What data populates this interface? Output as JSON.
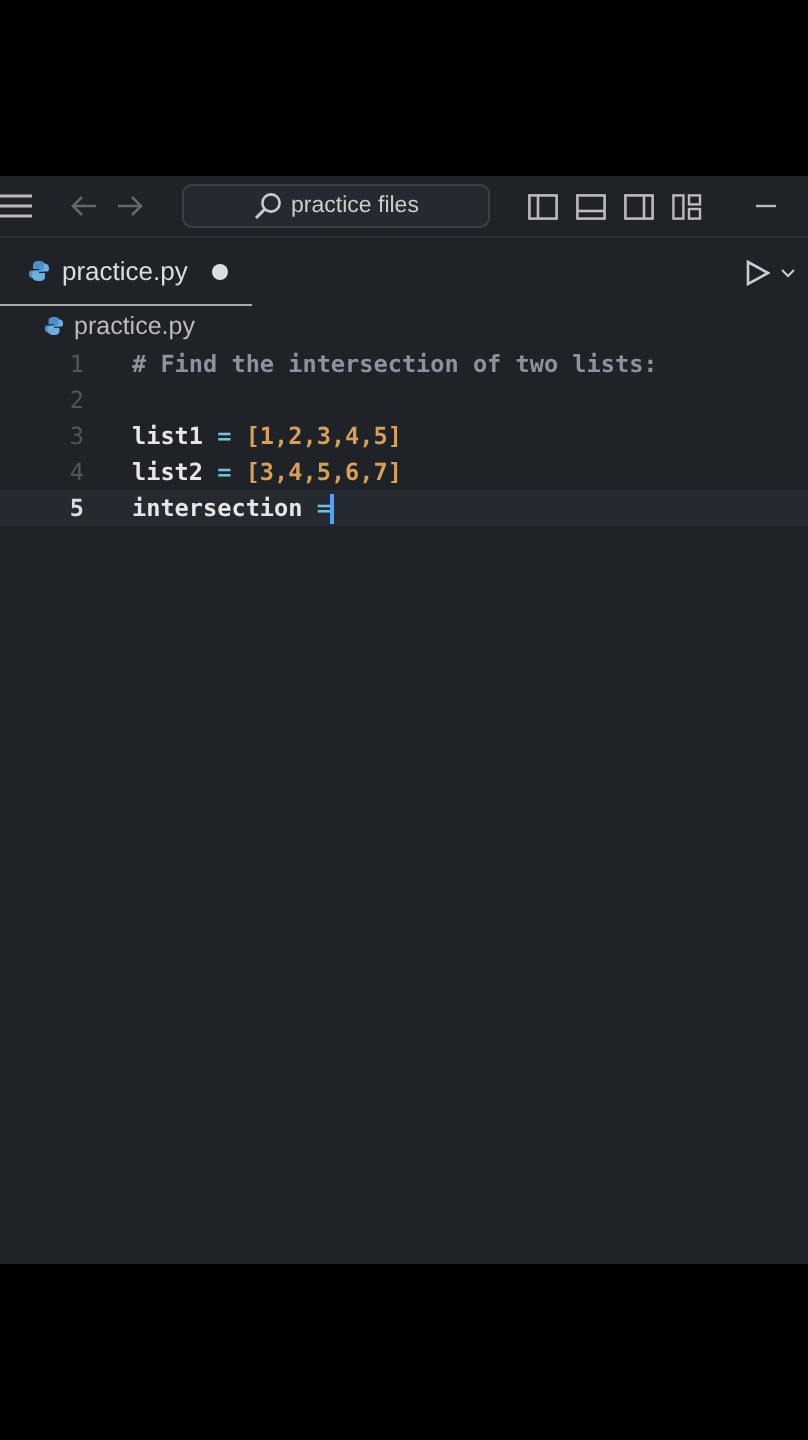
{
  "title_bar": {
    "search": {
      "value": "practice files"
    }
  },
  "tabs": [
    {
      "label": "practice.py",
      "selected": true,
      "modified": true
    }
  ],
  "breadcrumb": "practice.py",
  "editor": {
    "lines": [
      {
        "number": "1",
        "current": false,
        "tokens": [
          {
            "text": "# Find the intersection of two lists:",
            "kind": "comment"
          }
        ]
      },
      {
        "number": "2",
        "current": false
      },
      {
        "number": "3",
        "current": false,
        "tokens": [
          {
            "text": "list1",
            "kind": "name"
          },
          {
            "text": " = ",
            "kind": "op"
          },
          {
            "text": "[1,2,3,4,5]",
            "kind": "bracket"
          }
        ]
      },
      {
        "number": "4",
        "current": false,
        "tokens": [
          {
            "text": "list2",
            "kind": "name"
          },
          {
            "text": " = ",
            "kind": "op"
          },
          {
            "text": "[3,4,5,6,7]",
            "kind": "bracket"
          }
        ]
      },
      {
        "number": "5",
        "current": true,
        "tokens": [
          {
            "text": "intersection",
            "kind": "name"
          },
          {
            "text": " =",
            "kind": "op"
          }
        ]
      }
    ]
  }
}
